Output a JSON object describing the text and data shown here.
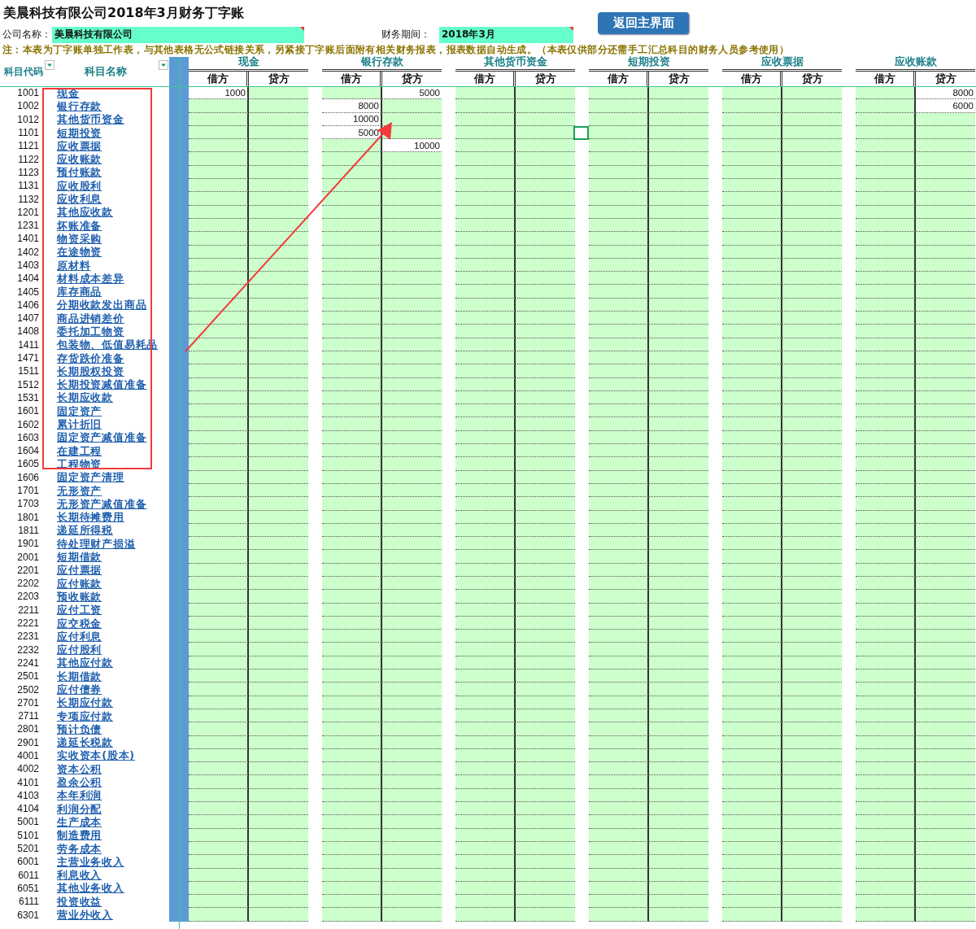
{
  "title": "美晨科技有限公司2018年3月财务丁字账",
  "back_button": "返回主界面",
  "company": {
    "label": "公司名称：",
    "value": "美晨科技有限公司"
  },
  "period": {
    "label": "财务期间：",
    "value": "2018年3月"
  },
  "note": "注：本表为丁字账单独工作表，与其他表格无公式链接关系，另紧接丁字账后面附有相关财务报表，报表数据自动生成。（本表仅供部分还需手工汇总科目的财务人员参考使用）",
  "columns": {
    "code": "科目代码",
    "name": "科目名称"
  },
  "groups": [
    {
      "name": "现金",
      "debit": "借方",
      "credit": "贷方"
    },
    {
      "name": "银行存款",
      "debit": "借方",
      "credit": "贷方"
    },
    {
      "name": "其他货币资金",
      "debit": "借方",
      "credit": "贷方"
    },
    {
      "name": "短期投资",
      "debit": "借方",
      "credit": "贷方"
    },
    {
      "name": "应收票据",
      "debit": "借方",
      "credit": "贷方"
    },
    {
      "name": "应收账款",
      "debit": "借方",
      "credit": "贷方"
    }
  ],
  "rows": [
    {
      "code": "1001",
      "name": "现金",
      "cells": [
        {
          "filled": true,
          "amount": "1000"
        },
        {
          "filled": false
        },
        {
          "filled": false
        },
        {
          "filled": true,
          "amount": "5000"
        },
        {
          "filled": false
        },
        {
          "filled": false
        },
        {
          "filled": false
        },
        {
          "filled": false
        },
        {
          "filled": false
        },
        {
          "filled": false
        },
        {
          "filled": false
        },
        {
          "filled": true,
          "amount": "8000"
        }
      ]
    },
    {
      "code": "1002",
      "name": "银行存款",
      "cells": [
        {
          "filled": false
        },
        {
          "filled": false
        },
        {
          "filled": true,
          "amount": "8000"
        },
        {
          "filled": false
        },
        {
          "filled": false
        },
        {
          "filled": false
        },
        {
          "filled": false
        },
        {
          "filled": false
        },
        {
          "filled": false
        },
        {
          "filled": false
        },
        {
          "filled": false
        },
        {
          "filled": true,
          "amount": "6000"
        }
      ]
    },
    {
      "code": "1012",
      "name": "其他货币资金",
      "cells": [
        {
          "filled": false
        },
        {
          "filled": false
        },
        {
          "filled": true,
          "amount": "10000"
        }
      ]
    },
    {
      "code": "1101",
      "name": "短期投资",
      "cells": [
        {
          "filled": false
        },
        {
          "filled": false
        },
        {
          "filled": true,
          "amount": "5000"
        }
      ]
    },
    {
      "code": "1121",
      "name": "应收票据",
      "cells": [
        {
          "filled": false
        },
        {
          "filled": false
        },
        {
          "filled": false
        },
        {
          "filled": true,
          "amount": "10000"
        }
      ]
    },
    {
      "code": "1122",
      "name": "应收账款"
    },
    {
      "code": "1123",
      "name": "预付账款"
    },
    {
      "code": "1131",
      "name": "应收股利"
    },
    {
      "code": "1132",
      "name": "应收利息"
    },
    {
      "code": "1201",
      "name": "其他应收款"
    },
    {
      "code": "1231",
      "name": "坏账准备"
    },
    {
      "code": "1401",
      "name": "物资采购"
    },
    {
      "code": "1402",
      "name": "在途物资"
    },
    {
      "code": "1403",
      "name": "原材料"
    },
    {
      "code": "1404",
      "name": "材料成本差异"
    },
    {
      "code": "1405",
      "name": "库存商品"
    },
    {
      "code": "1406",
      "name": "分期收款发出商品"
    },
    {
      "code": "1407",
      "name": "商品进销差价"
    },
    {
      "code": "1408",
      "name": "委托加工物资"
    },
    {
      "code": "1411",
      "name": "包装物、低值易耗品"
    },
    {
      "code": "1471",
      "name": "存货跌价准备"
    },
    {
      "code": "1511",
      "name": "长期股权投资"
    },
    {
      "code": "1512",
      "name": "长期投资减值准备"
    },
    {
      "code": "1531",
      "name": "长期应收款"
    },
    {
      "code": "1601",
      "name": "固定资产"
    },
    {
      "code": "1602",
      "name": "累计折旧"
    },
    {
      "code": "1603",
      "name": "固定资产减值准备"
    },
    {
      "code": "1604",
      "name": "在建工程"
    },
    {
      "code": "1605",
      "name": "工程物资"
    },
    {
      "code": "1606",
      "name": "固定资产清理"
    },
    {
      "code": "1701",
      "name": "无形资产"
    },
    {
      "code": "1703",
      "name": "无形资产减值准备"
    },
    {
      "code": "1801",
      "name": "长期待摊费用"
    },
    {
      "code": "1811",
      "name": "递延所得税"
    },
    {
      "code": "1901",
      "name": "待处理财产损溢"
    },
    {
      "code": "2001",
      "name": "短期借款"
    },
    {
      "code": "2201",
      "name": "应付票据"
    },
    {
      "code": "2202",
      "name": "应付账款"
    },
    {
      "code": "2203",
      "name": "预收账款"
    },
    {
      "code": "2211",
      "name": "应付工资"
    },
    {
      "code": "2221",
      "name": "应交税金"
    },
    {
      "code": "2231",
      "name": "应付利息"
    },
    {
      "code": "2232",
      "name": "应付股利"
    },
    {
      "code": "2241",
      "name": "其他应付款"
    },
    {
      "code": "2501",
      "name": "长期借款"
    },
    {
      "code": "2502",
      "name": "应付债券"
    },
    {
      "code": "2701",
      "name": "长期应付款"
    },
    {
      "code": "2711",
      "name": "专项应付款"
    },
    {
      "code": "2801",
      "name": "预计负债"
    },
    {
      "code": "2901",
      "name": "递延长税款"
    },
    {
      "code": "4001",
      "name": "实收资本(股本)"
    },
    {
      "code": "4002",
      "name": "资本公积"
    },
    {
      "code": "4101",
      "name": "盈余公积"
    },
    {
      "code": "4103",
      "name": "本年利润"
    },
    {
      "code": "4104",
      "name": "利润分配"
    },
    {
      "code": "5001",
      "name": "生产成本"
    },
    {
      "code": "5101",
      "name": "制造费用"
    },
    {
      "code": "5201",
      "name": "劳务成本"
    },
    {
      "code": "6001",
      "name": "主营业务收入"
    },
    {
      "code": "6011",
      "name": "利息收入"
    },
    {
      "code": "6051",
      "name": "其他业务收入"
    },
    {
      "code": "6111",
      "name": "投资收益"
    },
    {
      "code": "6301",
      "name": "营业外收入"
    }
  ]
}
